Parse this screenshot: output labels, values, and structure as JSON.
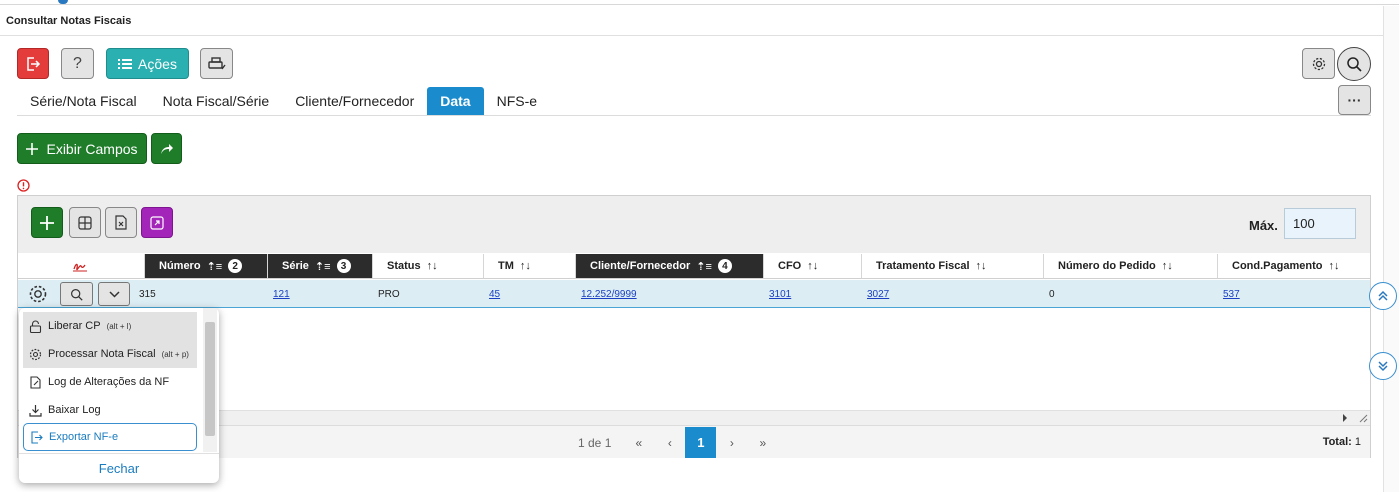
{
  "window": {
    "title": "Consultar Notas Fiscais"
  },
  "toolbar": {
    "acoes_label": "Ações",
    "help_label": "?",
    "more_label": "···"
  },
  "tabs": [
    {
      "label": "Série/Nota Fiscal"
    },
    {
      "label": "Nota Fiscal/Série"
    },
    {
      "label": "Cliente/Fornecedor"
    },
    {
      "label": "Data",
      "active": true
    },
    {
      "label": "NFS-e"
    }
  ],
  "actions": {
    "exibir_campos_label": "Exibir Campos"
  },
  "grid": {
    "max_label": "Máx.",
    "max_value": "100",
    "columns": [
      {
        "label": "Número",
        "sort_order": "2"
      },
      {
        "label": "Série",
        "sort_order": "3"
      },
      {
        "label": "Status"
      },
      {
        "label": "TM"
      },
      {
        "label": "Cliente/Fornecedor",
        "sort_order": "4"
      },
      {
        "label": "CFO"
      },
      {
        "label": "Tratamento Fiscal"
      },
      {
        "label": "Número do Pedido"
      },
      {
        "label": "Cond.Pagamento"
      }
    ],
    "rows": [
      {
        "numero": "315",
        "serie": "121",
        "status": "PRO",
        "tm": "45",
        "cliente": "12.252/9999",
        "cfo": "3101",
        "tratamento": "3027",
        "pedido": "0",
        "cond_pagamento": "537"
      }
    ],
    "pager": {
      "range": "1 de 1",
      "current_page": "1"
    },
    "total_label": "Total:",
    "total_value": "1"
  },
  "row_menu": {
    "items": [
      {
        "label": "Liberar CP",
        "shortcut": "(alt + l)"
      },
      {
        "label": "Processar Nota Fiscal",
        "shortcut": "(alt + p)"
      },
      {
        "label": "Log de Alterações da NF"
      },
      {
        "label": "Baixar Log"
      },
      {
        "label": "Exportar NF-e"
      }
    ],
    "close_label": "Fechar"
  },
  "colors": {
    "danger": "#e43b3b",
    "teal": "#2bb0b1",
    "primary": "#1a8ccd",
    "success": "#1f7d2a",
    "purple": "#a224b8",
    "header_dark": "#2c2c2c",
    "row_selected": "#dcedf3"
  }
}
